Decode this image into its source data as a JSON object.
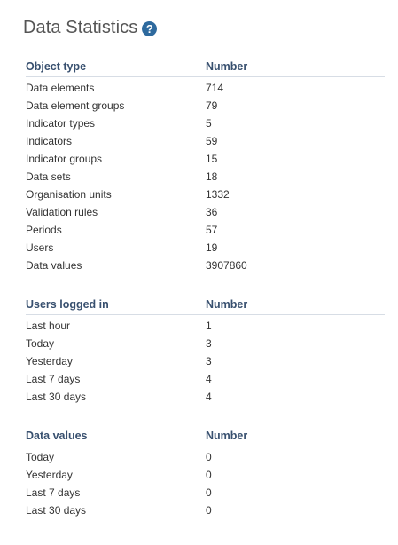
{
  "header": {
    "title": "Data Statistics",
    "help_icon": "?"
  },
  "object_table": {
    "col_type": "Object type",
    "col_number": "Number",
    "rows": [
      {
        "label": "Data elements",
        "value": "714"
      },
      {
        "label": "Data element groups",
        "value": "79"
      },
      {
        "label": "Indicator types",
        "value": "5"
      },
      {
        "label": "Indicators",
        "value": "59"
      },
      {
        "label": "Indicator groups",
        "value": "15"
      },
      {
        "label": "Data sets",
        "value": "18"
      },
      {
        "label": "Organisation units",
        "value": "1332"
      },
      {
        "label": "Validation rules",
        "value": "36"
      },
      {
        "label": "Periods",
        "value": "57"
      },
      {
        "label": "Users",
        "value": "19"
      },
      {
        "label": "Data values",
        "value": "3907860"
      }
    ]
  },
  "users_table": {
    "col_type": "Users logged in",
    "col_number": "Number",
    "rows": [
      {
        "label": "Last hour",
        "value": "1"
      },
      {
        "label": "Today",
        "value": "3"
      },
      {
        "label": "Yesterday",
        "value": "3"
      },
      {
        "label": "Last 7 days",
        "value": "4"
      },
      {
        "label": "Last 30 days",
        "value": "4"
      }
    ]
  },
  "values_table": {
    "col_type": "Data values",
    "col_number": "Number",
    "rows": [
      {
        "label": "Today",
        "value": "0"
      },
      {
        "label": "Yesterday",
        "value": "0"
      },
      {
        "label": "Last 7 days",
        "value": "0"
      },
      {
        "label": "Last 30 days",
        "value": "0"
      }
    ]
  }
}
